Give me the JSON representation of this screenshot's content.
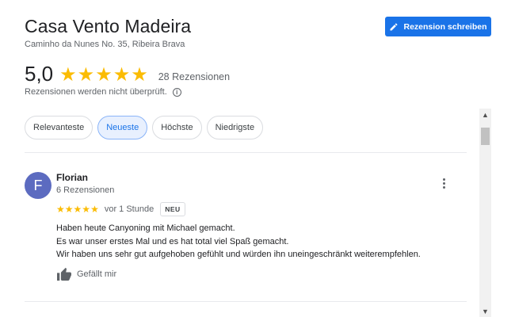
{
  "header": {
    "title": "Casa Vento Madeira",
    "address": "Caminho da Nunes No. 35, Ribeira Brava",
    "write_review_label": "Rezension schreiben"
  },
  "summary": {
    "rating": "5,0",
    "stars": "★★★★★",
    "review_count": "28 Rezensionen",
    "disclaimer": "Rezensionen werden nicht überprüft."
  },
  "sort_chips": [
    {
      "label": "Relevanteste",
      "active": false
    },
    {
      "label": "Neueste",
      "active": true
    },
    {
      "label": "Höchste",
      "active": false
    },
    {
      "label": "Niedrigste",
      "active": false
    }
  ],
  "reviews": [
    {
      "avatar_letter": "F",
      "avatar_color": "#5c6bc0",
      "name": "Florian",
      "reviewer_stats": "6 Rezensionen",
      "stars": "★★★★★",
      "rating": 5,
      "time": "vor 1 Stunde",
      "badge": "NEU",
      "text_lines": [
        "Haben heute Canyoning mit Michael gemacht.",
        "Es war unser erstes Mal und es hat total viel Spaß gemacht.",
        "Wir haben uns sehr gut aufgehoben gefühlt und würden ihn uneingeschränkt weiterempfehlen."
      ],
      "like_label": "Gefällt mir"
    }
  ],
  "colors": {
    "accent": "#1a73e8",
    "star": "#fbbc04",
    "active_chip_bg": "#e8f0fe"
  },
  "icons": {
    "write": "pencil-icon",
    "info": "info-icon",
    "more": "more-vert-icon",
    "like": "thumb-up-icon"
  }
}
